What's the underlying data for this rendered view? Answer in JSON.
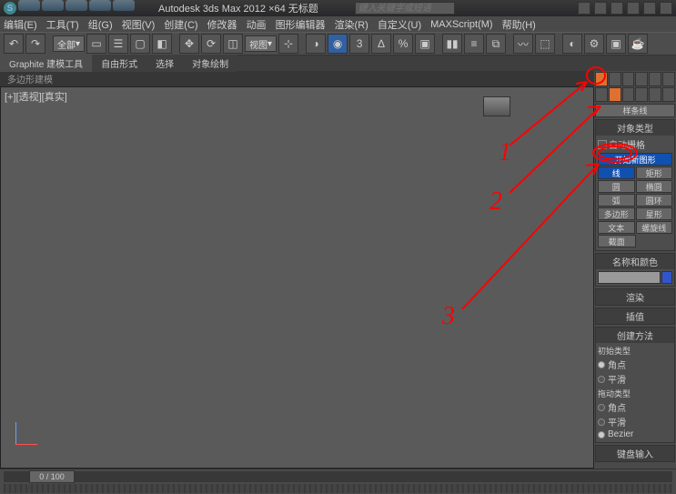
{
  "title": "Autodesk 3ds Max 2012 ×64    无标题",
  "search_placeholder": "键入关键字或短语",
  "menu": [
    "编辑(E)",
    "工具(T)",
    "组(G)",
    "视图(V)",
    "创建(C)",
    "修改器",
    "动画",
    "图形编辑器",
    "渲染(R)",
    "自定义(U)",
    "MAXScript(M)",
    "帮助(H)"
  ],
  "quick_dropdown": "全部",
  "view_dropdown": "视图",
  "ribbon_tabs": [
    "Graphite 建模工具",
    "自由形式",
    "选择",
    "对象绘制"
  ],
  "ribbon_sub": "多边形建模",
  "viewport_label": "[+][透视][真实]",
  "timeslider": "0 / 100",
  "panel": {
    "splines_header": "样条线",
    "object_type": "对象类型",
    "autogrid": "自动栅格",
    "start_new": "开始新图形",
    "btns": {
      "line": "线",
      "rect": "矩形",
      "circle": "圆",
      "ellipse": "椭圆",
      "arc": "弧",
      "donut": "圆环",
      "polygon": "多边形",
      "star": "星形",
      "text": "文本",
      "helix": "螺旋线",
      "section": "截面"
    },
    "name_color": "名称和颜色",
    "render": "渲染",
    "interp": "插值",
    "create_method": "创建方法",
    "initial_type": "初始类型",
    "drag_type": "拖动类型",
    "corner": "角点",
    "smooth": "平滑",
    "bezier": "Bezier",
    "keyboard": "键盘输入"
  },
  "annotations": {
    "a1": "1",
    "a2": "2",
    "a3": "3"
  }
}
